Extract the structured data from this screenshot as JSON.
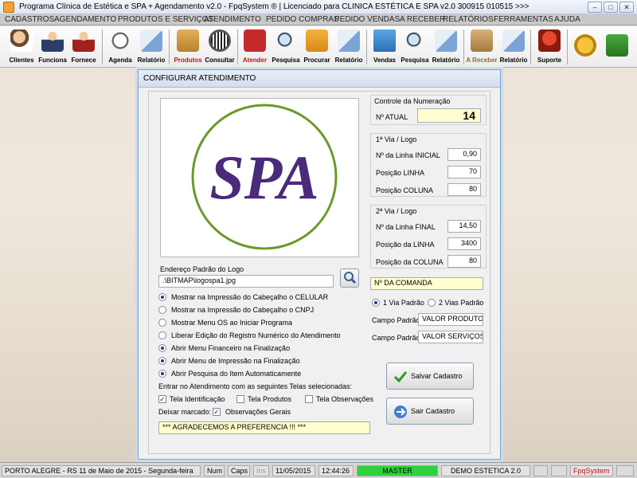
{
  "window": {
    "title": "Programa Clínica de Estética e SPA + Agendamento v2.0 - FpqSystem ® | Licenciado para  CLINICA ESTÉTICA E SPA v2.0 300915 010515 >>>",
    "min": "‒",
    "max": "□",
    "close": "✕"
  },
  "menu": [
    "CADASTROS",
    "AGENDAMENTO",
    "PRODUTOS E SERVIÇOS",
    "ATENDIMENTO",
    "PEDIDO COMPRAS",
    "PEDIDO VENDAS",
    "A RECEBER",
    "RELATÓRIOS",
    "FERRAMENTAS",
    "AJUDA"
  ],
  "toolbar": {
    "clientes": "Clientes",
    "funciona": "Funciona",
    "fornece": "Fornece",
    "agenda": "Agenda",
    "relatorio1": "Relatório",
    "produtos": "Produtos",
    "consultar": "Consultar",
    "atender": "Atender",
    "pesquisa1": "Pesquisa",
    "procurar": "Procurar",
    "relatorio2": "Relatório",
    "vendas": "Vendas",
    "pesquisa2": "Pesquisa",
    "relatorio3": "Relatório",
    "areceber": "A Receber",
    "relatorio4": "Relatório",
    "suporte": "Suporte"
  },
  "dialog": {
    "title": "CONFIGURAR ATENDIMENTO",
    "logo_text": "SPA",
    "logo_path_label": "Endereço Padrão do Logo",
    "logo_path": ".\\BITMAP\\logospa1.jpg",
    "options": [
      {
        "label": "Mostrar na Impressão do Cabeçalho o CELULAR",
        "on": true
      },
      {
        "label": "Mostrar na Impressão do Cabeçalho o CNPJ",
        "on": false
      },
      {
        "label": "Mostrar Menu OS ao Iniciar Programa",
        "on": false
      },
      {
        "label": "Liberar Edição do Registro Numérico do Atendimento",
        "on": false
      },
      {
        "label": "Abrir Menu Financeiro na Finalização",
        "on": true
      },
      {
        "label": "Abrir Menu de Impressão na Finalização",
        "on": true
      },
      {
        "label": "Abrir Pesquisa do Item Automaticamente",
        "on": true
      }
    ],
    "screens_label": "Entrar no Atendimento com as seguintes Telas selecionadas:",
    "tela_identificacao": "Tela Identificação",
    "tela_produtos": "Tela Produtos",
    "tela_observacoes": "Tela Observações",
    "deixar_marcado": "Deixar marcado:",
    "observacoes_gerais": "Observações Gerais",
    "footer_message": "*** AGRADECEMOS A PREFERENCIA !!! ***",
    "numeracao": {
      "title": "Controle da Numeração",
      "label": "Nº ATUAL",
      "value": "14"
    },
    "via1": {
      "title": "1ª Via / Logo",
      "linha_inicial_label": "Nº da Linha INICIAL",
      "linha_inicial": "0,90",
      "posicao_linha_label": "Posição LINHA",
      "posicao_linha": "70",
      "posicao_coluna_label": "Posição COLUNA",
      "posicao_coluna": "80"
    },
    "via2": {
      "title": "2ª Via / Logo",
      "linha_final_label": "Nº da Linha FINAL",
      "linha_final": "14,50",
      "posicao_linha_label": "Posição da LINHA",
      "posicao_linha": "3400",
      "posicao_coluna_label": "Posição da COLUNA",
      "posicao_coluna": "80"
    },
    "comanda": {
      "label": "Nº DA COMANDA",
      "via1": "1 Via Padrão",
      "via2": "2 Vias Padrão",
      "campo_label": "Campo Padrão",
      "campo1": "VALOR PRODUTOS",
      "campo2": "VALOR SERVIÇOS"
    },
    "save_label": "Salvar Cadastro",
    "exit_label": "Sair Cadastro"
  },
  "status": {
    "city_date": "PORTO ALEGRE - RS 11 de Maio de 2015 - Segunda-feira",
    "num": "Num",
    "caps": "Caps",
    "ins": "Ins",
    "date": "11/05/2015",
    "time": "12:44:26",
    "user": "MASTER",
    "company": "DEMO ESTETICA 2.0",
    "brand": "FpqSystem"
  }
}
